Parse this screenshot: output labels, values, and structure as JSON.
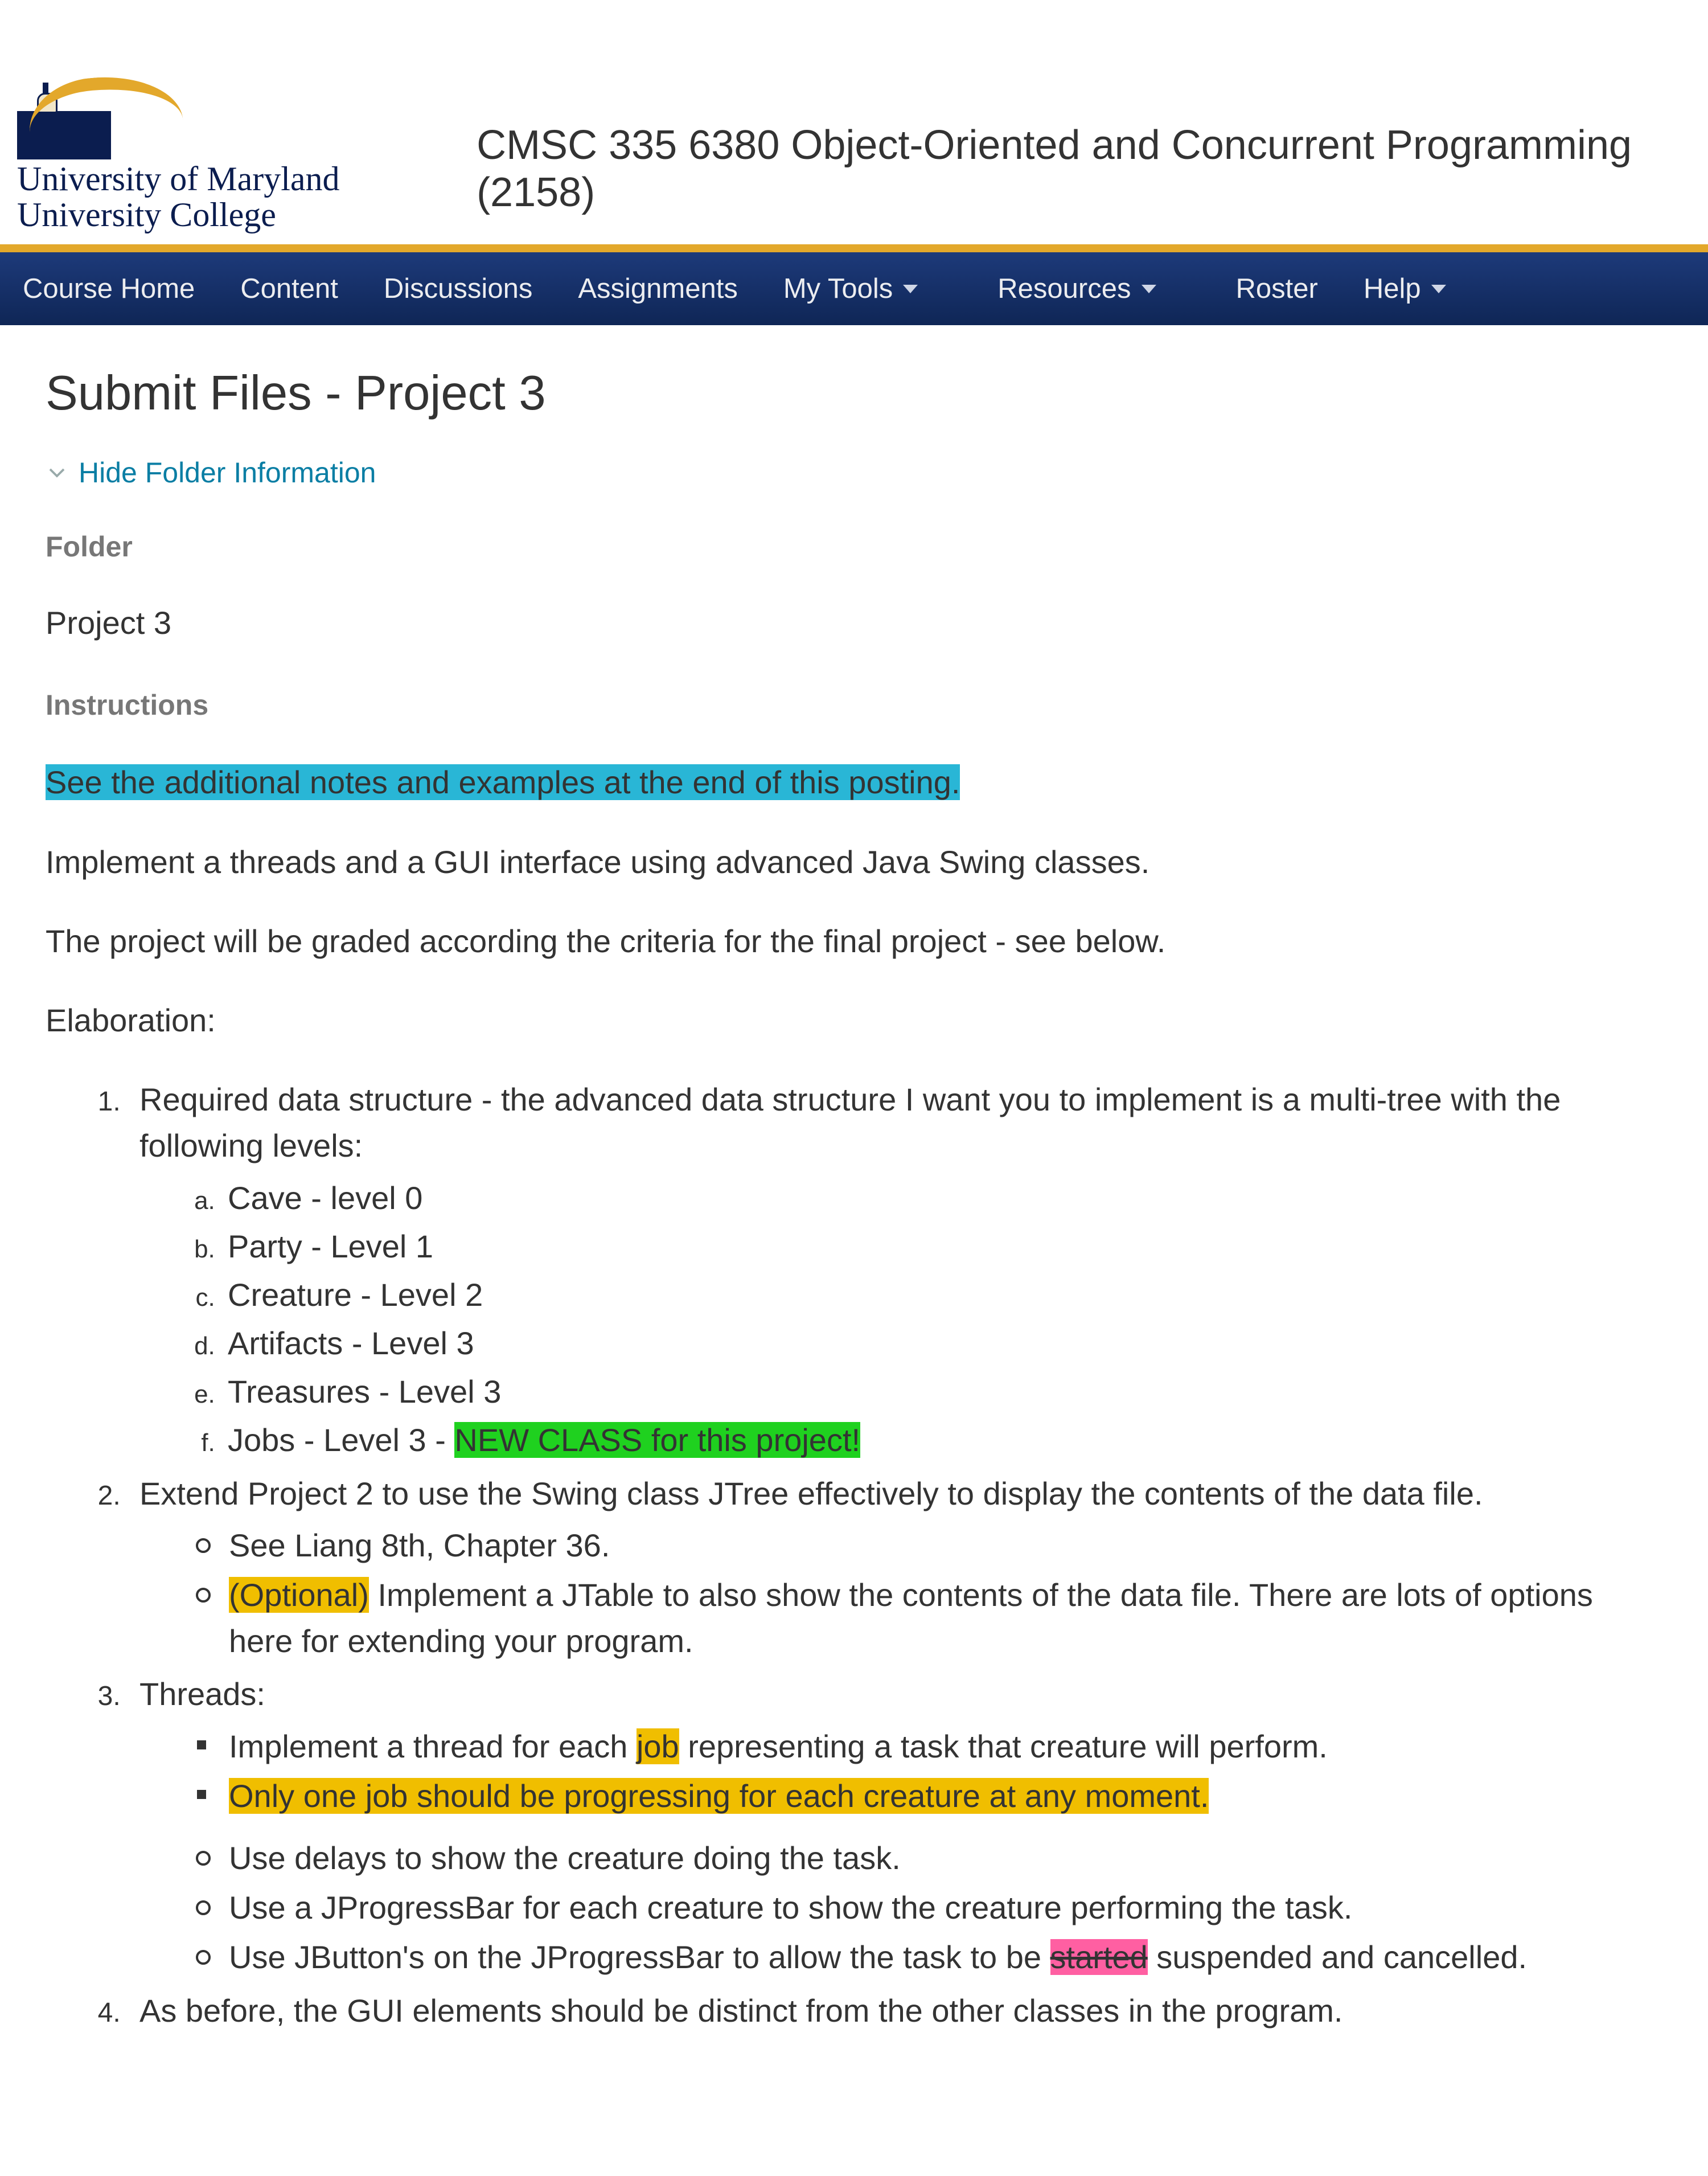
{
  "header": {
    "logo_line1": "University of Maryland",
    "logo_line2": "University College",
    "course_title": "CMSC 335 6380 Object-Oriented and Concurrent Programming (2158)"
  },
  "nav": [
    {
      "label": "Course Home",
      "dropdown": false
    },
    {
      "label": "Content",
      "dropdown": false
    },
    {
      "label": "Discussions",
      "dropdown": false
    },
    {
      "label": "Assignments",
      "dropdown": false
    },
    {
      "label": "My Tools",
      "dropdown": true
    },
    {
      "label": "Resources",
      "dropdown": true
    },
    {
      "label": "Roster",
      "dropdown": false
    },
    {
      "label": "Help",
      "dropdown": true
    }
  ],
  "page": {
    "title": "Submit Files - Project 3",
    "toggle_label": "Hide Folder Information",
    "folder_label": "Folder",
    "folder_name": "Project 3",
    "instructions_label": "Instructions"
  },
  "instr": {
    "highlighted_intro": "See the additional notes and examples at the end of this posting.",
    "p1": "Implement a threads and a GUI interface using advanced Java Swing classes.",
    "p2": "The project will be graded according the criteria for the final project - see below.",
    "p3": "Elaboration:",
    "li1_lead": "Required data structure - the advanced data structure I want you to implement is a multi-tree with the following levels:",
    "li1a": "Cave - level 0",
    "li1b": "Party - Level 1",
    "li1c": "Creature - Level 2",
    "li1d": "Artifacts - Level 3",
    "li1e": "Treasures - Level 3",
    "li1f_pre": "Jobs - Level 3 - ",
    "li1f_hl": "NEW CLASS for this project!",
    "li2_lead": "Extend Project 2 to use the Swing class JTree effectively to display the contents of the data file.",
    "li2_a": "See Liang 8th, Chapter 36.",
    "li2_b_hl": "(Optional)",
    "li2_b_rest": " Implement a JTable to also show the contents of the data file. There are lots of options here for extending your program.",
    "li3_lead": "Threads:",
    "li3_sq1_pre": "Implement a thread for each ",
    "li3_sq1_hl": "job",
    "li3_sq1_post": " representing a task that creature will perform.",
    "li3_sq2_hl": "Only one job should be progressing for each creature at any moment.",
    "li3_c1": "Use delays to show the creature doing the task.",
    "li3_c2": "Use a JProgressBar for each creature to show the creature performing the task.",
    "li3_c3_pre": "Use JButton's on the JProgressBar to allow the task to be ",
    "li3_c3_strike": "started",
    "li3_c3_post": " suspended and cancelled.",
    "li4": "As before, the GUI elements should be distinct from the other classes in the program."
  }
}
